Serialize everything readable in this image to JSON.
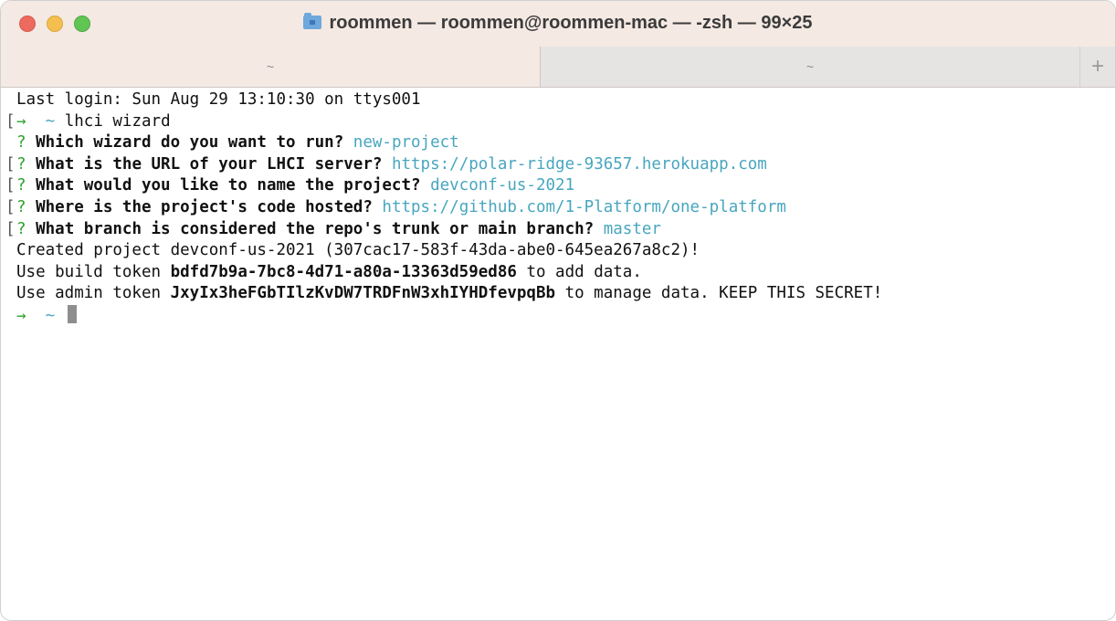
{
  "window": {
    "title": "roommen — roommen@roommen-mac — -zsh — 99×25",
    "colors": {
      "close": "#ed6a5e",
      "minimize": "#f5bf4f",
      "zoom": "#61c554",
      "prompt_arrow": "#2aa22a",
      "answer": "#48a6bf"
    }
  },
  "tabs": [
    {
      "label": "~",
      "active": true
    },
    {
      "label": "~",
      "active": false
    }
  ],
  "new_tab_label": "+",
  "terminal": {
    "last_login": "Last login: Sun Aug 29 13:10:30 on ttys001",
    "prompt_arrow": "→",
    "prompt_dir": "~",
    "command": "lhci wizard",
    "questions": [
      {
        "mark": "?",
        "question": "Which wizard do you want to run?",
        "answer": "new-project"
      },
      {
        "mark": "?",
        "question": "What is the URL of your LHCI server?",
        "answer": "https://polar-ridge-93657.herokuapp.com"
      },
      {
        "mark": "?",
        "question": "What would you like to name the project?",
        "answer": "devconf-us-2021"
      },
      {
        "mark": "?",
        "question": "Where is the project's code hosted?",
        "answer": "https://github.com/1-Platform/one-platform"
      },
      {
        "mark": "?",
        "question": "What branch is considered the repo's trunk or main branch?",
        "answer": "master"
      }
    ],
    "created": "Created project devconf-us-2021 (307cac17-583f-43da-abe0-645ea267a8c2)!",
    "build_token_prefix": "Use build token",
    "build_token": "bdfd7b9a-7bc8-4d71-a80a-13363d59ed86",
    "build_token_suffix": "to add data.",
    "admin_token_prefix": "Use admin token",
    "admin_token": "JxyIx3heFGbTIlzKvDW7TRDFnW3xhIYHDfevpqBb",
    "admin_token_suffix": "to manage data. KEEP THIS SECRET!"
  }
}
